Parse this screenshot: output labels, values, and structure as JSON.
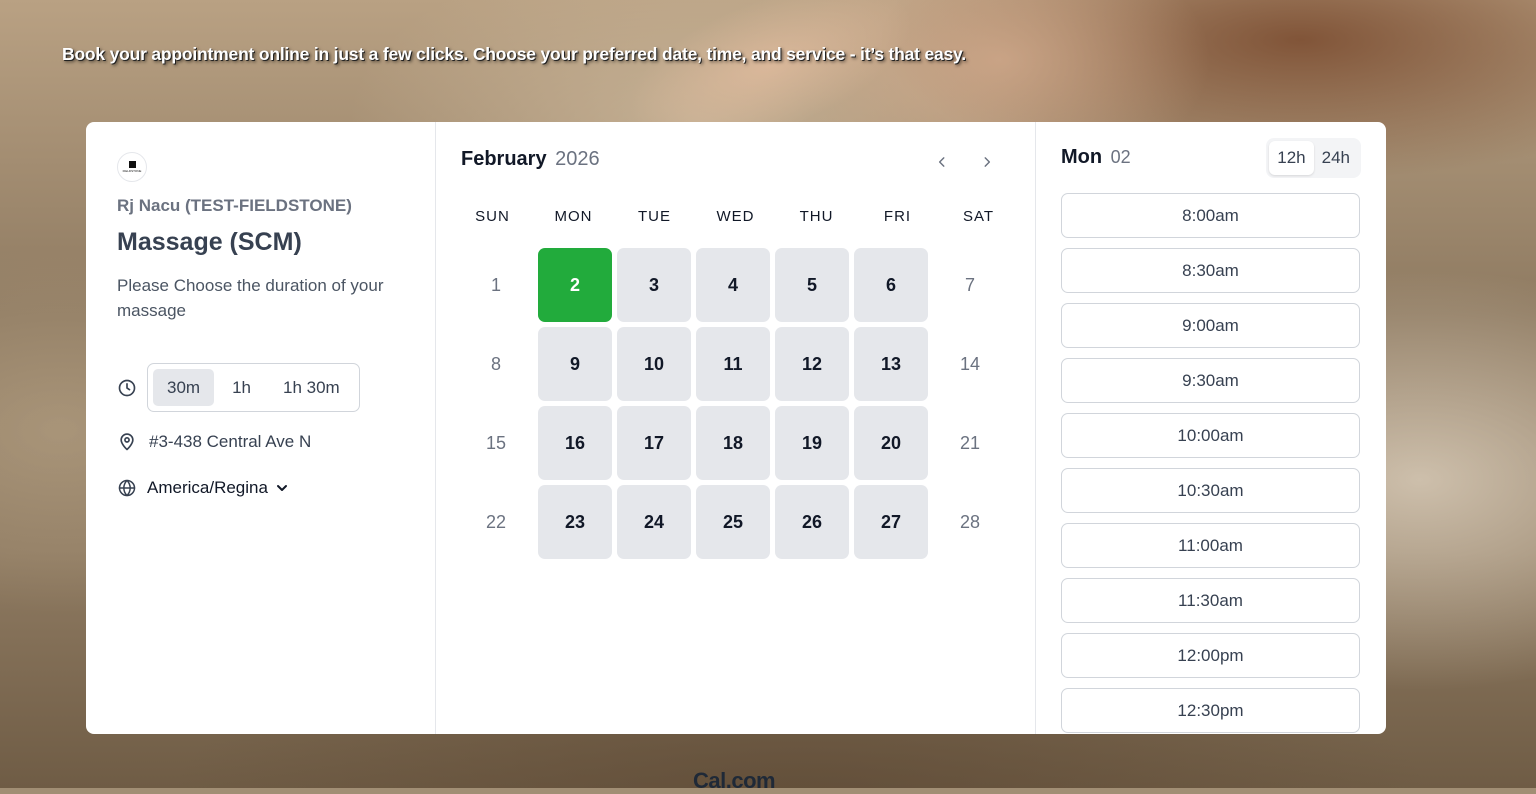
{
  "hero": {
    "text": "Book your appointment online in just a few clicks. Choose your preferred date, time, and service - it’s that easy."
  },
  "profile": {
    "avatar_text": "FIELDSTONE",
    "host": "Rj Nacu (TEST-FIELDSTONE)",
    "event_title": "Massage (SCM)",
    "description": "Please Choose the duration of your massage",
    "durations": [
      "30m",
      "1h",
      "1h 30m"
    ],
    "selected_duration": "30m",
    "location": "#3-438 Central Ave N",
    "timezone": "America/Regina"
  },
  "calendar": {
    "month": "February",
    "year": "2026",
    "weekdays": [
      "SUN",
      "MON",
      "TUE",
      "WED",
      "THU",
      "FRI",
      "SAT"
    ],
    "days": [
      {
        "d": "1",
        "state": "off"
      },
      {
        "d": "2",
        "state": "selected"
      },
      {
        "d": "3",
        "state": "available"
      },
      {
        "d": "4",
        "state": "available"
      },
      {
        "d": "5",
        "state": "available"
      },
      {
        "d": "6",
        "state": "available"
      },
      {
        "d": "7",
        "state": "off"
      },
      {
        "d": "8",
        "state": "off"
      },
      {
        "d": "9",
        "state": "available"
      },
      {
        "d": "10",
        "state": "available"
      },
      {
        "d": "11",
        "state": "available"
      },
      {
        "d": "12",
        "state": "available"
      },
      {
        "d": "13",
        "state": "available"
      },
      {
        "d": "14",
        "state": "off"
      },
      {
        "d": "15",
        "state": "off"
      },
      {
        "d": "16",
        "state": "available"
      },
      {
        "d": "17",
        "state": "available"
      },
      {
        "d": "18",
        "state": "available"
      },
      {
        "d": "19",
        "state": "available"
      },
      {
        "d": "20",
        "state": "available"
      },
      {
        "d": "21",
        "state": "off"
      },
      {
        "d": "22",
        "state": "off"
      },
      {
        "d": "23",
        "state": "available"
      },
      {
        "d": "24",
        "state": "available"
      },
      {
        "d": "25",
        "state": "available"
      },
      {
        "d": "26",
        "state": "available"
      },
      {
        "d": "27",
        "state": "available"
      },
      {
        "d": "28",
        "state": "off"
      }
    ],
    "selected_color": "#22ab3c"
  },
  "slots": {
    "day_name": "Mon",
    "day_num": "02",
    "formats": [
      "12h",
      "24h"
    ],
    "active_format": "12h",
    "times": [
      "8:00am",
      "8:30am",
      "9:00am",
      "9:30am",
      "10:00am",
      "10:30am",
      "11:00am",
      "11:30am",
      "12:00pm",
      "12:30pm"
    ]
  },
  "footer": {
    "brand": "Cal.com"
  },
  "icons": {
    "duration": "clock-icon",
    "location": "map-pin-icon",
    "timezone": "globe-icon",
    "timezone_toggle": "chevron-down-icon",
    "prev": "chevron-left-icon",
    "next": "chevron-right-icon"
  }
}
